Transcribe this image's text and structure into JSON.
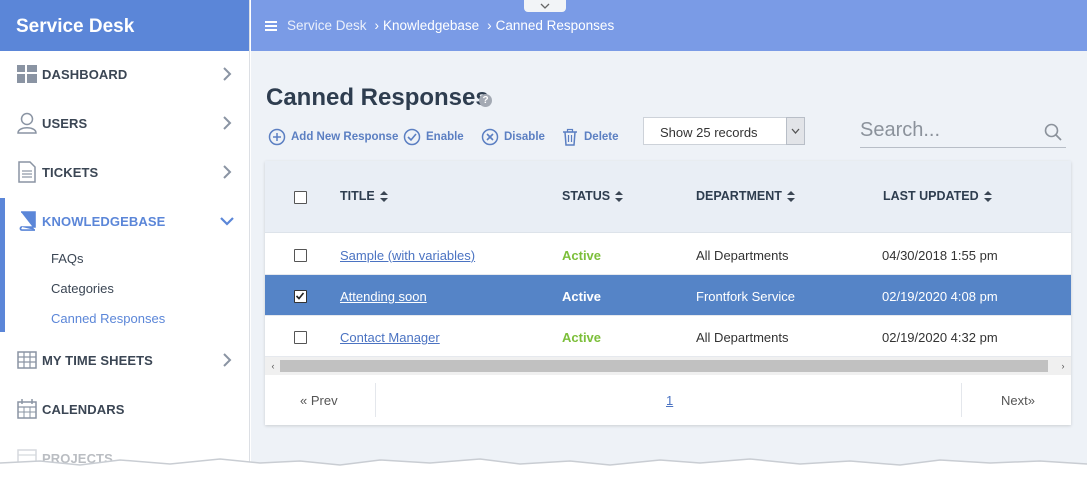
{
  "app": {
    "title": "Service Desk"
  },
  "sidebar": {
    "items": [
      {
        "label": "DASHBOARD",
        "icon": "dashboard-icon"
      },
      {
        "label": "USERS",
        "icon": "user-icon"
      },
      {
        "label": "TICKETS",
        "icon": "ticket-icon"
      },
      {
        "label": "KNOWLEDGEBASE",
        "icon": "book-icon",
        "active": true
      },
      {
        "label": "MY TIME SHEETS",
        "icon": "timesheet-icon"
      },
      {
        "label": "CALENDARS",
        "icon": "calendar-icon"
      },
      {
        "label": "PROJECTS",
        "icon": "projects-icon"
      }
    ],
    "subitems": [
      {
        "label": "FAQs"
      },
      {
        "label": "Categories"
      },
      {
        "label": "Canned Responses",
        "active": true
      }
    ]
  },
  "breadcrumb": [
    "Service Desk",
    "Knowledgebase",
    "Canned Responses"
  ],
  "page": {
    "title": "Canned Responses"
  },
  "toolbar": {
    "add_label": "Add New Response",
    "enable_label": "Enable",
    "disable_label": "Disable",
    "delete_label": "Delete",
    "records_select": "Show 25 records",
    "search_placeholder": "Search..."
  },
  "table": {
    "columns": [
      "TITLE",
      "STATUS",
      "DEPARTMENT",
      "LAST UPDATED"
    ],
    "rows": [
      {
        "title": "Sample (with variables)",
        "status": "Active",
        "department": "All Departments",
        "last_updated": "04/30/2018 1:55 pm",
        "checked": false
      },
      {
        "title": "Attending soon",
        "status": "Active",
        "department": "Frontfork Service",
        "last_updated": "02/19/2020 4:08 pm",
        "checked": true
      },
      {
        "title": "Contact Manager",
        "status": "Active",
        "department": "All Departments",
        "last_updated": "02/19/2020 4:32 pm",
        "checked": false
      }
    ]
  },
  "pager": {
    "prev": "« Prev",
    "page": "1",
    "next": "Next»"
  },
  "colors": {
    "brand": "#5b86d8",
    "topbar": "#7a9be6",
    "selected_row": "#5584c7",
    "status_active": "#7cbf3a",
    "link": "#4b73c2"
  }
}
